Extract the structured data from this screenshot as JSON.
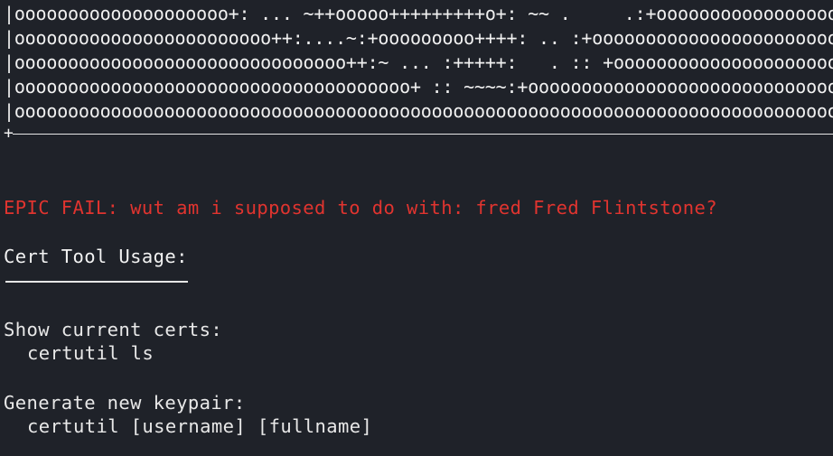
{
  "ascii_art": {
    "lines": [
      "|oooooooooooooooooooo+: ... ~++ooooo+++++++++o+: ~~ .     .:+ooooooooooooooooo",
      "|oooooooooooooooooooooooo++:....~:+ooooooooo++++: .. :+ooooooooooooooooooooooo",
      "|ooooooooooooooooooooooooooooooo++:~ ... :+++++:   . :: +ooooooooooooooooooooooooo",
      "|ooooooooooooooooooooooooooooooooooooo+ :: ~~~~:+ooooooooooooooooooooooooooooooo",
      "|oooooooooooooooooooooooooooooooooooooooooooooooooooooooooooooooooooooooooooooooo"
    ],
    "corner": "+"
  },
  "error_message": "EPIC FAIL: wut am i supposed to do with: fred Fred Flintstone?",
  "usage": {
    "title": "Cert Tool Usage:",
    "sections": [
      {
        "heading": "Show current certs:",
        "command": "certutil ls"
      },
      {
        "heading": "Generate new keypair:",
        "command": "certutil [username] [fullname]"
      }
    ]
  },
  "colors": {
    "background": "#1f2229",
    "foreground": "#e8e8e8",
    "error": "#e0342f"
  }
}
